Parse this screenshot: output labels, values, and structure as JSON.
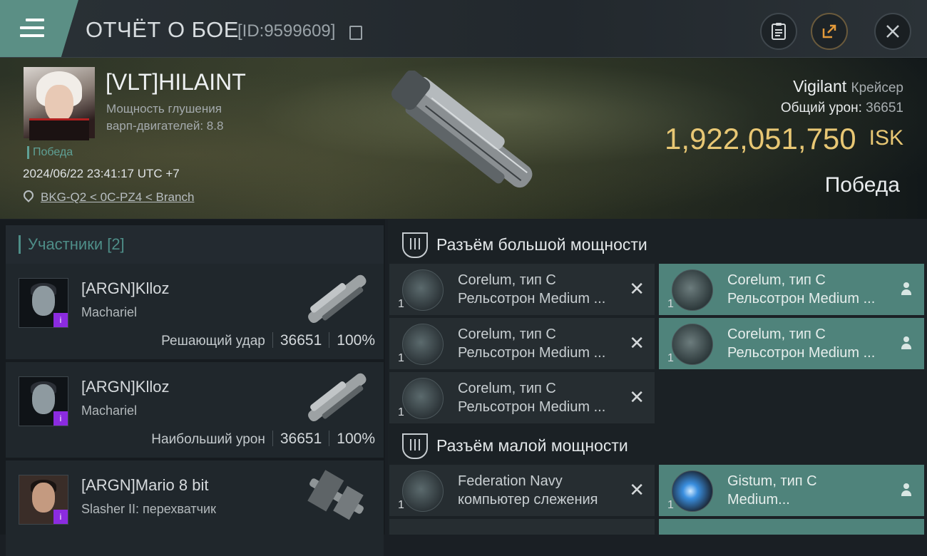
{
  "header": {
    "title": "ОТЧЁТ О БОЕ",
    "report_id": "[ID:9599609]"
  },
  "victim": {
    "name": "[VLT]HILAINT",
    "stat_line1": "Мощность глушения",
    "stat_line2": "варп-двигателей: 8.8",
    "tag": "Победа",
    "datetime": "2024/06/22 23:41:17 UTC +7",
    "location": "BKG-Q2 < 0C-PZ4 < Branch",
    "ship": "Vigilant",
    "ship_class": "Крейсер",
    "total_damage_label": "Общий урон:",
    "total_damage": "36651",
    "isk_value": "1,922,051,750",
    "isk_unit": "ISK",
    "result": "Победа"
  },
  "participants": {
    "header": "Участники [2]",
    "rows": [
      {
        "name": "[ARGN]Klloz",
        "ship": "Machariel",
        "role": "Решающий удар",
        "damage": "36651",
        "percent": "100%"
      },
      {
        "name": "[ARGN]Klloz",
        "ship": "Machariel",
        "role": "Наибольший урон",
        "damage": "36651",
        "percent": "100%"
      },
      {
        "name": "[ARGN]Mario 8 bit",
        "ship": "Slasher II: перехватчик"
      }
    ]
  },
  "fittings": {
    "high_title": "Разъём большой мощности",
    "low_title": "Разъём малой мощности",
    "high_slots": [
      {
        "line1": "Corelum, тип C",
        "line2": "Рельсотрон Medium ...",
        "qty": "1",
        "state": "destroyed"
      },
      {
        "line1": "Corelum, тип C",
        "line2": "Рельсотрон Medium ...",
        "qty": "1",
        "state": "dropped"
      },
      {
        "line1": "Corelum, тип C",
        "line2": "Рельсотрон Medium ...",
        "qty": "1",
        "state": "destroyed"
      },
      {
        "line1": "Corelum, тип C",
        "line2": "Рельсотрон Medium ...",
        "qty": "1",
        "state": "dropped"
      },
      {
        "line1": "Corelum, тип C",
        "line2": "Рельсотрон Medium ...",
        "qty": "1",
        "state": "destroyed"
      }
    ],
    "low_slots": [
      {
        "line1": "Federation Navy",
        "line2": "компьютер слежения",
        "qty": "1",
        "state": "destroyed"
      },
      {
        "line1": "Gistum, тип C",
        "line2": "Medium...",
        "qty": "1",
        "state": "dropped"
      }
    ]
  },
  "colors": {
    "accent_teal": "#4f837b",
    "isk_gold": "#e8c774",
    "victory_teal": "#5fa196"
  }
}
